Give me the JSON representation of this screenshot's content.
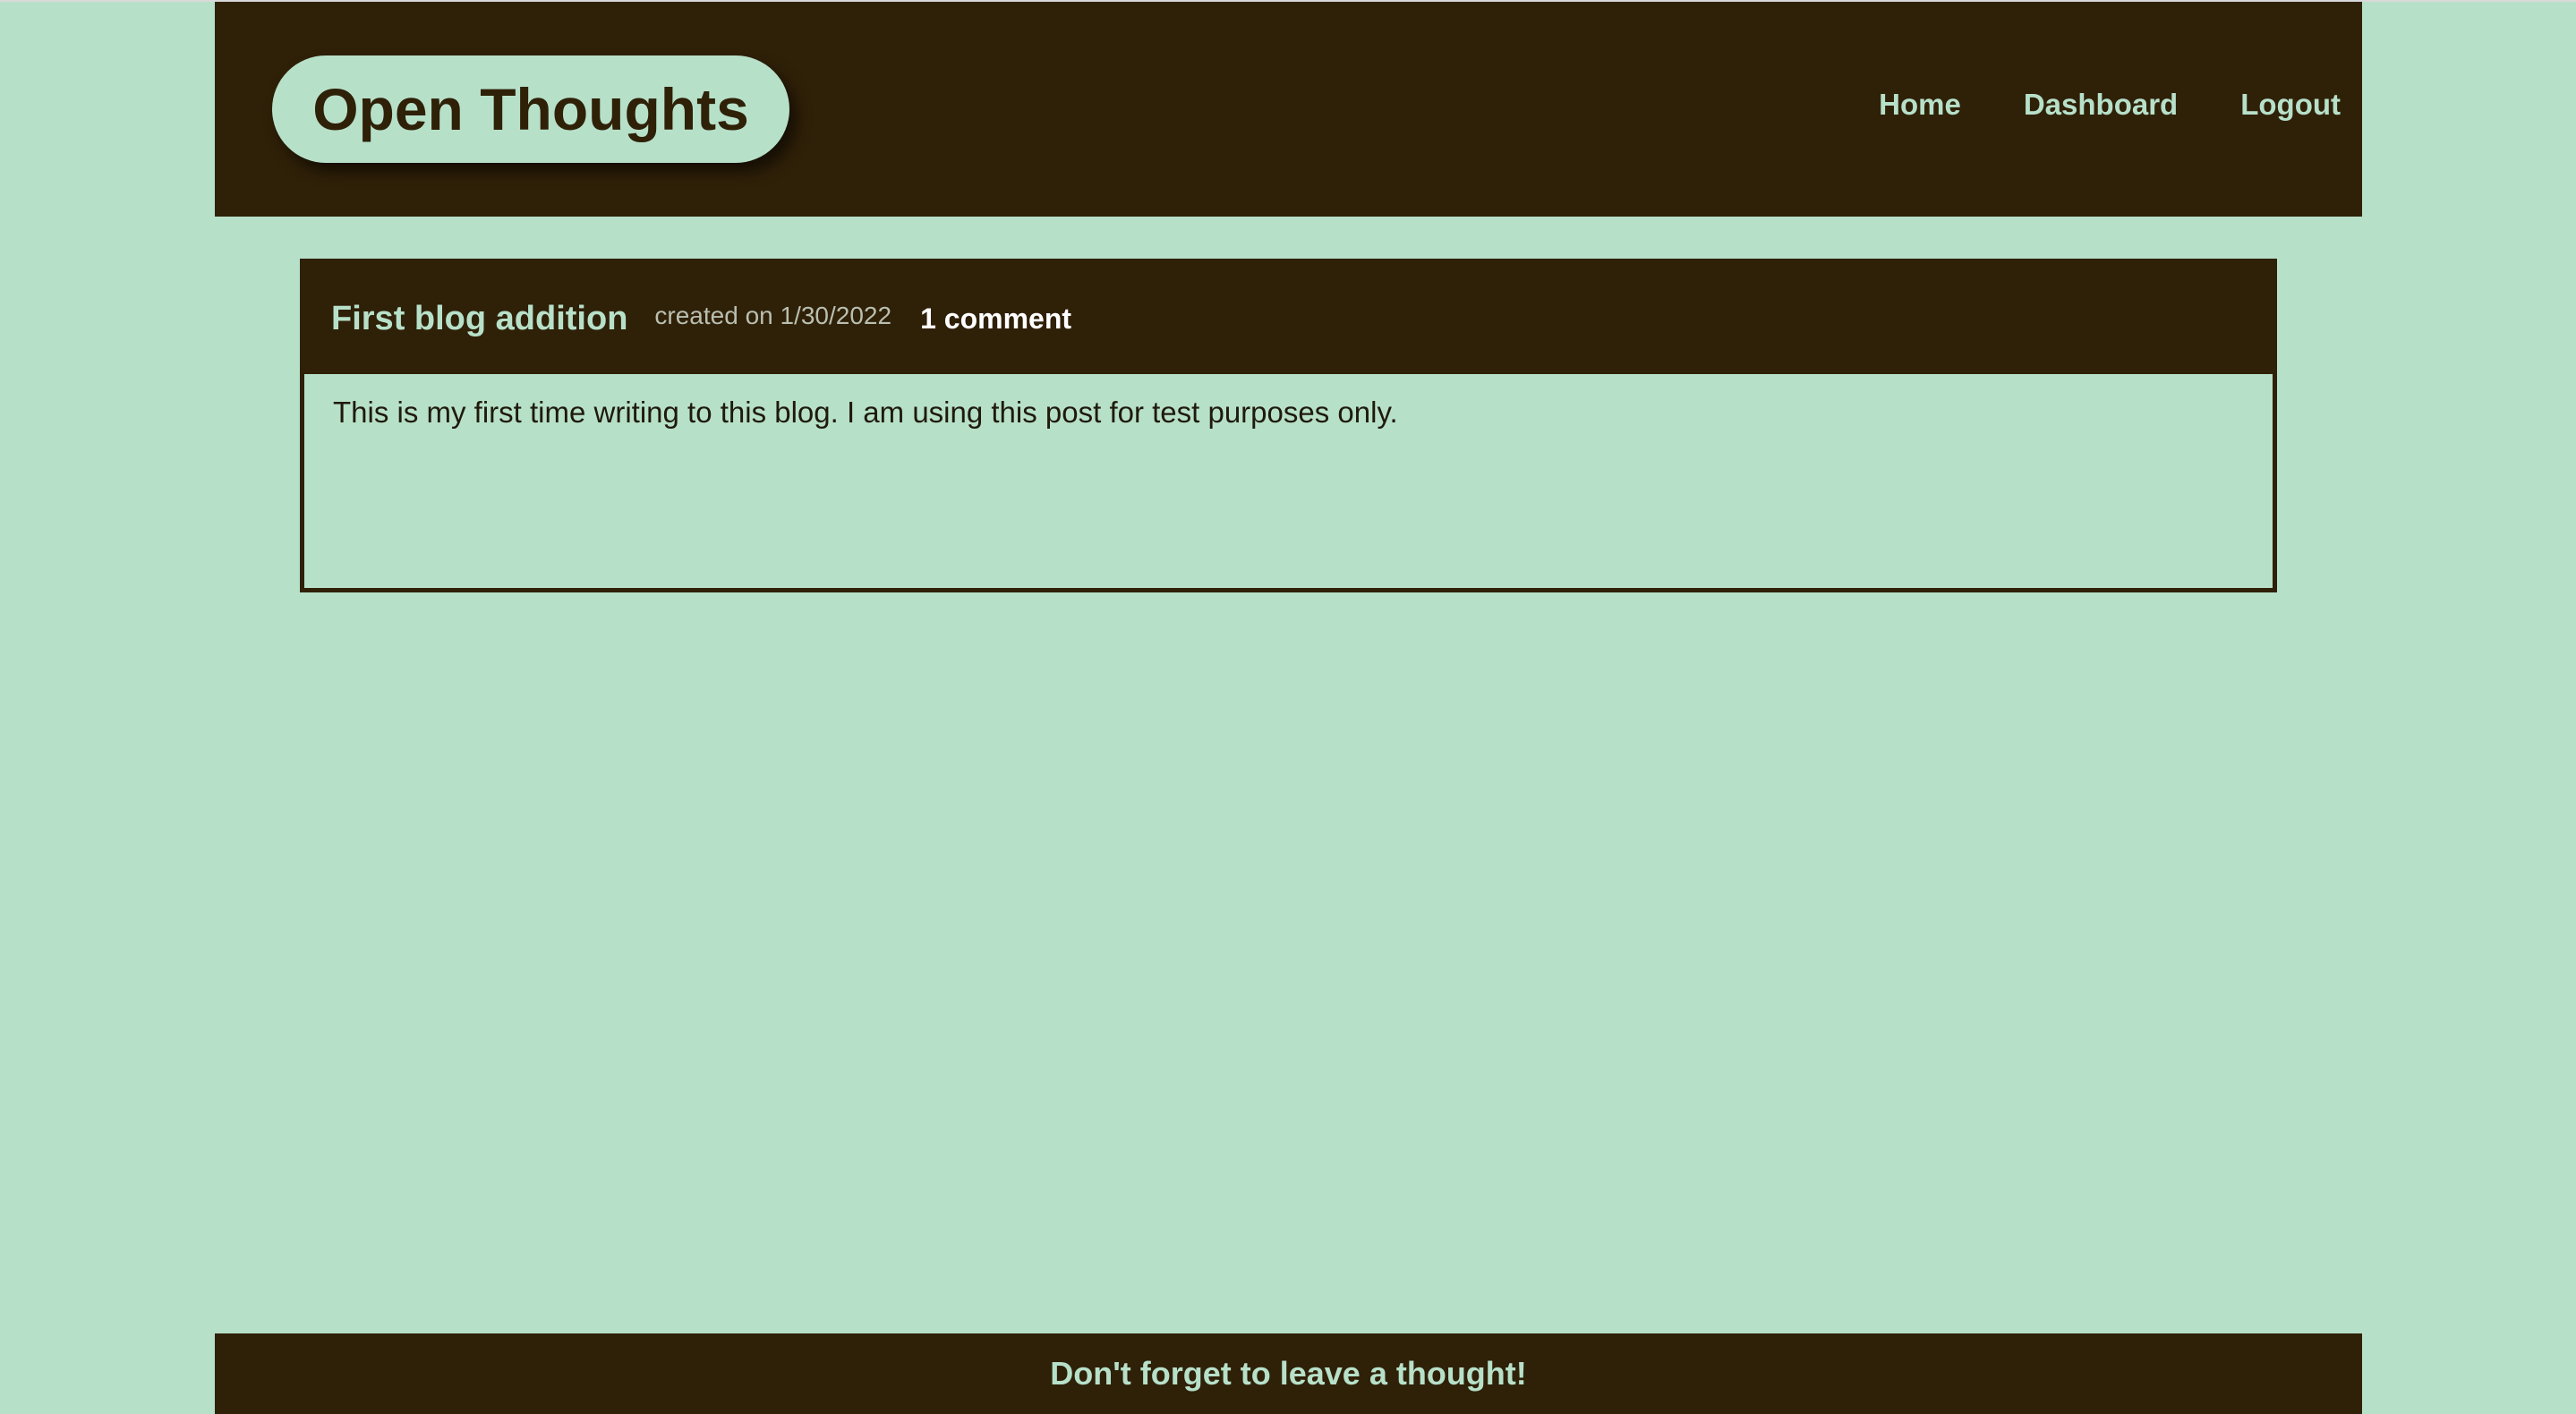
{
  "header": {
    "site_title": "Open Thoughts",
    "nav": [
      {
        "label": "Home"
      },
      {
        "label": "Dashboard"
      },
      {
        "label": "Logout"
      }
    ]
  },
  "post": {
    "title": "First blog addition",
    "created": "created on 1/30/2022",
    "comments": "1 comment",
    "body": "This is my first time writing to this blog. I am using this post for test purposes only."
  },
  "footer": {
    "text": "Don't forget to leave a thought!"
  },
  "colors": {
    "background": "#b7e0c9",
    "dark_brown": "#2f2008",
    "muted_date": "#b9bfb0",
    "comment_white": "#ffffff"
  }
}
